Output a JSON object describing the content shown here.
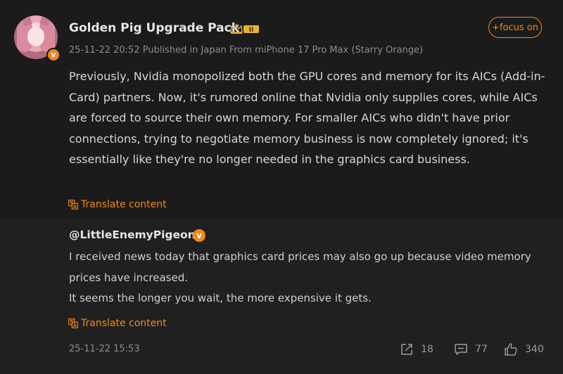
{
  "post": {
    "author": "Golden Pig Upgrade Pack",
    "crown_badge_icon": "crown-level-badge",
    "follow_label": "+focus on",
    "meta": "25-11-22 20:52  Published in Japan  From miPhone 17 Pro Max (Starry Orange)",
    "text": "Previously, Nvidia monopolized both the GPU cores and memory for its AICs (Add-in-Card) partners. Now, it's rumored online that Nvidia only supplies cores, while AICs are forced to source their own memory. For smaller AICs who didn't have prior connections, trying to negotiate memory business is now completely ignored; it's essentially like they're no longer needed in the graphics card business.",
    "translate_label": "Translate content"
  },
  "comment": {
    "author": "@LittleEnemyPigeon",
    "lines": [
      "I received news today that graphics card prices may also go up because video memory prices have increased.",
      "It seems the longer you wait, the more expensive it gets."
    ],
    "translate_label": "Translate content",
    "timestamp": "25-11-22 15:53",
    "shares": "18",
    "comments": "77",
    "likes": "340"
  },
  "colors": {
    "accent": "#f08a1b",
    "background": "#1b1b1b",
    "comment_background": "#202020"
  }
}
